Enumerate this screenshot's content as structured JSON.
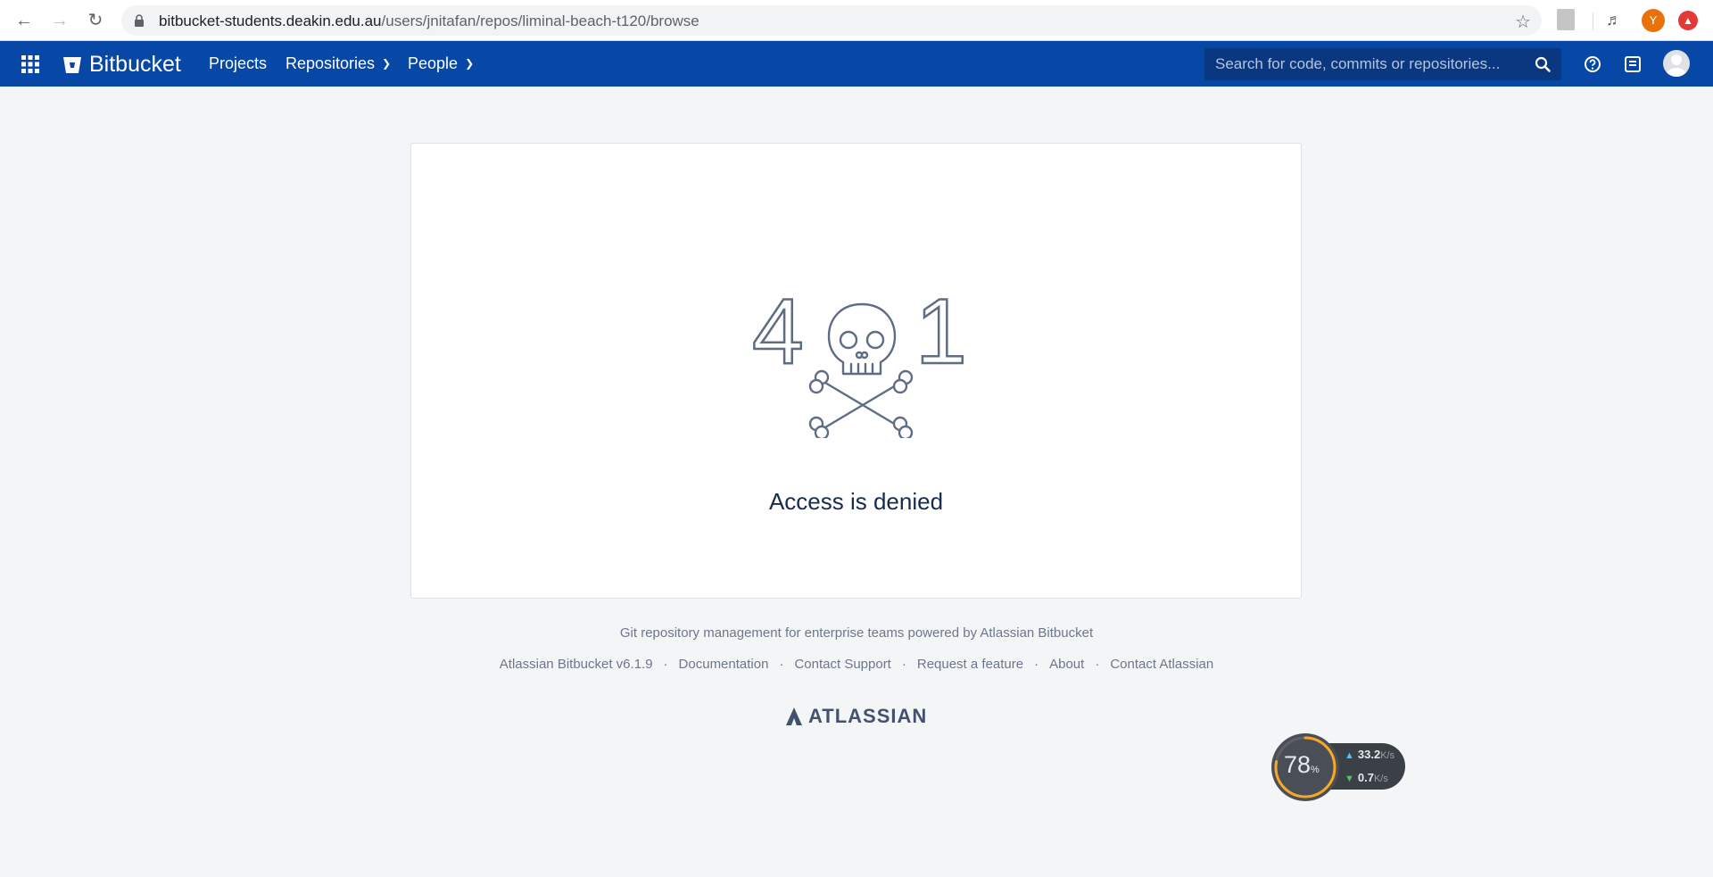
{
  "browser": {
    "url_host": "bitbucket-students.deakin.edu.au",
    "url_path": "/users/jnitafan/repos/liminal-beach-t120/browse",
    "profile_initial": "Y"
  },
  "header": {
    "logo_text": "Bitbucket",
    "nav": {
      "projects": "Projects",
      "repositories": "Repositories",
      "people": "People"
    },
    "search_placeholder": "Search for code, commits or repositories..."
  },
  "error": {
    "code_left": "4",
    "code_right": "1",
    "message": "Access is denied"
  },
  "footer": {
    "tagline": "Git repository management for enterprise teams powered by Atlassian Bitbucket",
    "links": {
      "version": "Atlassian Bitbucket v6.1.9",
      "documentation": "Documentation",
      "support": "Contact Support",
      "feature": "Request a feature",
      "about": "About",
      "contact": "Contact Atlassian"
    },
    "separator": "·",
    "atlassian_logo": "ATLASSIAN"
  },
  "net_widget": {
    "percent": "78",
    "percent_unit": "%",
    "percent_value": 0.78,
    "upload": "33.2",
    "download": "0.7",
    "unit": "K/s"
  },
  "colors": {
    "header_bg": "#0747a6",
    "page_bg": "#f4f5f7",
    "text_primary": "#172b4d",
    "text_muted": "#6b778c"
  }
}
